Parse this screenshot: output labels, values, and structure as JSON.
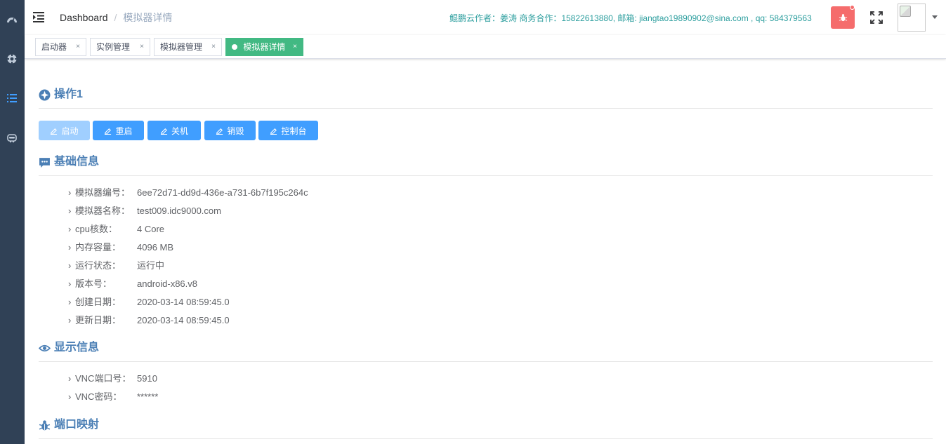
{
  "navbar": {
    "breadcrumb": [
      "Dashboard",
      "模拟器详情"
    ],
    "author_info": "鲲鹏云作者：姜涛 商务合作：15822613880, 邮箱: jiangtao19890902@sina.com , qq: 584379563"
  },
  "tags": [
    {
      "label": "启动器",
      "close": "×",
      "active": false
    },
    {
      "label": "实例管理",
      "close": "×",
      "active": false
    },
    {
      "label": "模拟器管理",
      "close": "×",
      "active": false
    },
    {
      "label": "模拟器详情",
      "close": "×",
      "active": true
    }
  ],
  "sections": {
    "operations": "操作1",
    "basic_info": "基础信息",
    "display_info": "显示信息",
    "port_mapping": "端口映射"
  },
  "buttons": {
    "start": "启动",
    "restart": "重启",
    "shutdown": "关机",
    "destroy": "销毁",
    "console": "控制台"
  },
  "basic_info": [
    {
      "label": "模拟器编号：",
      "value": "6ee72d71-dd9d-436e-a731-6b7f195c264c"
    },
    {
      "label": "模拟器名称：",
      "value": "test009.idc9000.com"
    },
    {
      "label": "cpu核数：",
      "value": "4 Core"
    },
    {
      "label": "内存容量：",
      "value": "4096 MB"
    },
    {
      "label": "运行状态：",
      "value": "运行中"
    },
    {
      "label": "版本号：",
      "value": "android-x86.v8"
    },
    {
      "label": "创建日期：",
      "value": "2020-03-14 08:59:45.0"
    },
    {
      "label": "更新日期：",
      "value": "2020-03-14 08:59:45.0"
    }
  ],
  "display_info": [
    {
      "label": "VNC端口号：",
      "value": "5910"
    },
    {
      "label": "VNC密码：",
      "value": "******"
    }
  ],
  "colors": {
    "sidebar": "#304156",
    "primary": "#409eff",
    "primary_disabled": "#a0cfff",
    "tag_active": "#42b983",
    "section_title": "#4b7fb5",
    "danger": "#f56c6c"
  }
}
